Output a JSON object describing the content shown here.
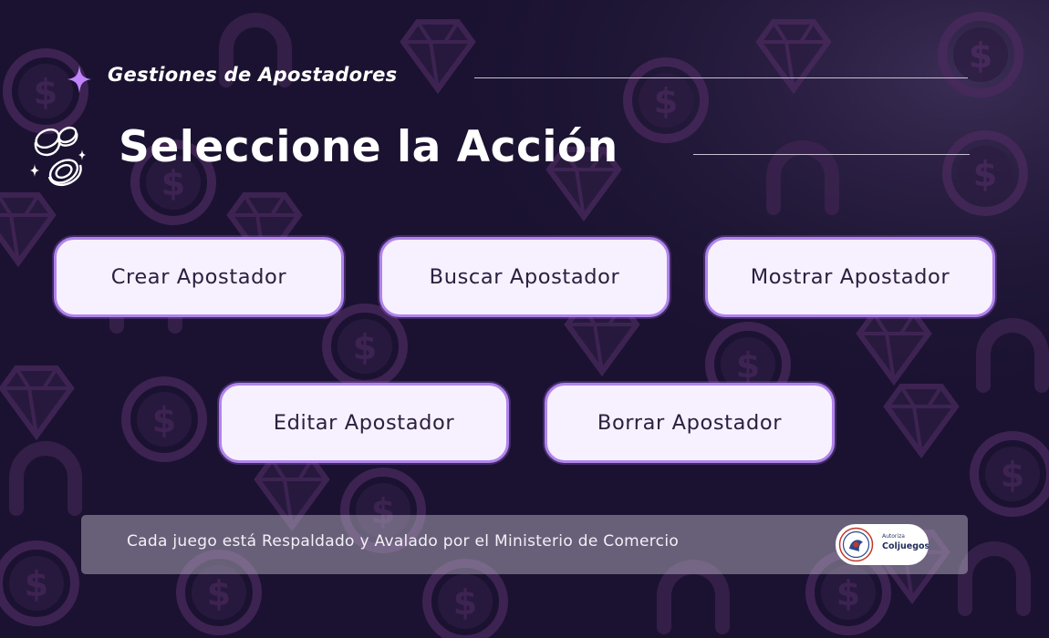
{
  "header": {
    "subtitle": "Gestiones de Apostadores",
    "title": "Seleccione la Acción",
    "icons": [
      "sparkle-icon",
      "coins-icon"
    ]
  },
  "actions": {
    "create": "Crear Apostador",
    "search": "Buscar Apostador",
    "show": "Mostrar Apostador",
    "edit": "Editar Apostador",
    "delete": "Borrar Apostador"
  },
  "footer": {
    "text": "Cada juego está Respaldado y Avalado por el Ministerio de Comercio",
    "logo_caption": "Autoriza",
    "logo_name": "Coljuegos"
  },
  "colors": {
    "background": "#1a1230",
    "button_fill": "#f7f0ff",
    "button_border": "#b184ec",
    "accent": "#c084fc"
  }
}
